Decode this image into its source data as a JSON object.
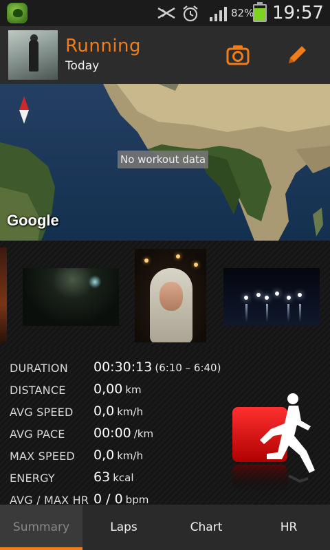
{
  "status_bar": {
    "battery_percent": "82%",
    "battery_level": 0.82,
    "time": "19:57",
    "icons": [
      "app-badge-icon",
      "mute-icon",
      "alarm-icon",
      "signal-icon",
      "battery-icon"
    ]
  },
  "header": {
    "title": "Running",
    "subtitle": "Today",
    "accent_color": "#f07d1a",
    "actions": [
      "camera-icon",
      "edit-icon"
    ]
  },
  "map": {
    "overlay_text": "No workout data",
    "attribution": "Google"
  },
  "photos": [
    "photo-1",
    "photo-2",
    "photo-3",
    "photo-4"
  ],
  "stats": [
    {
      "label": "DURATION",
      "value": "00:30:13",
      "extra": "(6:10 – 6:40)"
    },
    {
      "label": "DISTANCE",
      "value": "0,00",
      "unit": "km"
    },
    {
      "label": "AVG SPEED",
      "value": "0,0",
      "unit": "km/h"
    },
    {
      "label": "AVG PACE",
      "value": "00:00",
      "unit": "/km"
    },
    {
      "label": "MAX SPEED",
      "value": "0,0",
      "unit": "km/h"
    },
    {
      "label": "ENERGY",
      "value": "63",
      "unit": "kcal"
    },
    {
      "label": "AVG / MAX HR",
      "value": "0 / 0",
      "unit": "bpm"
    }
  ],
  "tabs": [
    {
      "label": "Summary",
      "active": true
    },
    {
      "label": "Laps",
      "active": false
    },
    {
      "label": "Chart",
      "active": false
    },
    {
      "label": "HR",
      "active": false
    }
  ]
}
